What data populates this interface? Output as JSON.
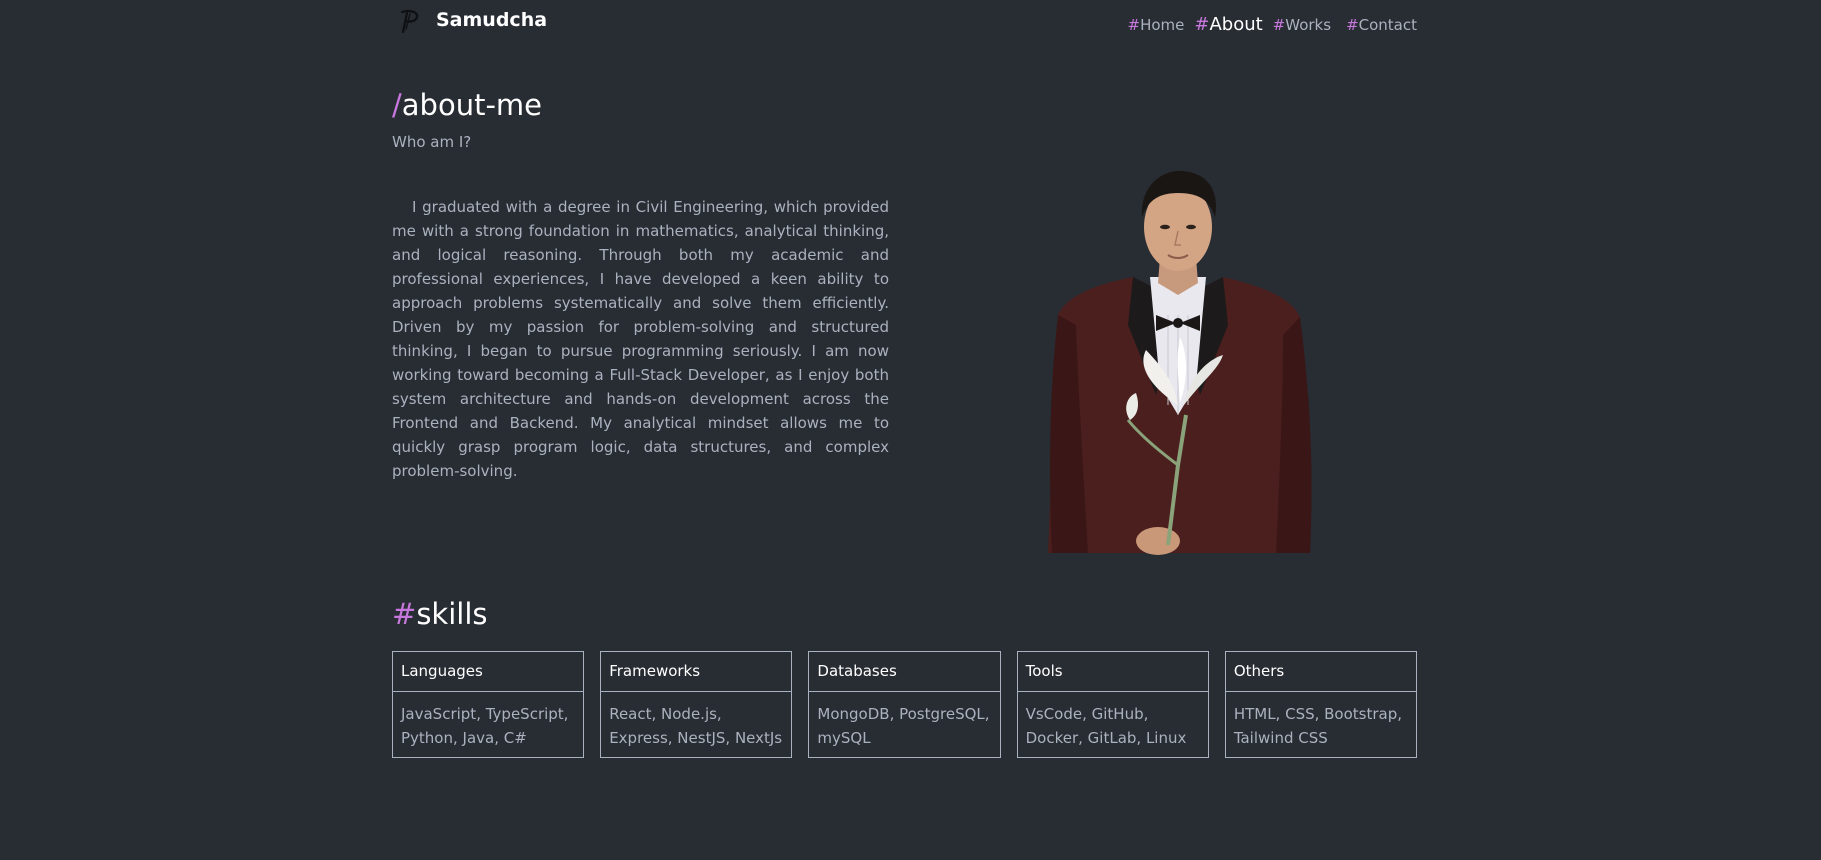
{
  "header": {
    "brand": "Samudcha",
    "nav": [
      {
        "hash": "#",
        "label": "Home"
      },
      {
        "hash": "#",
        "label": "About"
      },
      {
        "hash": "#",
        "label": "Works"
      },
      {
        "hash": "#",
        "label": "Contact"
      }
    ]
  },
  "about": {
    "title_prefix": "/",
    "title": "about-me",
    "subtitle": "Who am I?",
    "text": "I graduated with a degree in Civil Engineering, which provided me with a strong foundation in mathematics, analytical thinking, and logical reasoning. Through both my academic and professional experiences, I have developed a keen ability to approach problems systematically and solve them efficiently. Driven by my passion for problem-solving and structured thinking, I began to pursue programming seriously. I am now working toward becoming a Full-Stack Developer, as I enjoy both system architecture and hands-on development across the Frontend and Backend. My analytical mindset allows me to quickly grasp program logic, data structures, and complex problem-solving."
  },
  "skills": {
    "title_prefix": "#",
    "title": "skills",
    "cards": [
      {
        "heading": "Languages",
        "items": "JavaScript, TypeScript, Python, Java, C#"
      },
      {
        "heading": "Frameworks",
        "items": "React, Node.js, Express, NestJS, NextJs"
      },
      {
        "heading": "Databases",
        "items": "MongoDB, PostgreSQL, mySQL"
      },
      {
        "heading": "Tools",
        "items": "VsCode, GitHub, Docker, GitLab, Linux"
      },
      {
        "heading": "Others",
        "items": "HTML, CSS, Bootstrap, Tailwind CSS"
      }
    ]
  },
  "colors": {
    "background": "#282c33",
    "accent": "#c778dd",
    "text": "#abb2bf",
    "heading": "#ffffff"
  },
  "icons": {
    "logo": "stylized-p-logo-icon"
  }
}
